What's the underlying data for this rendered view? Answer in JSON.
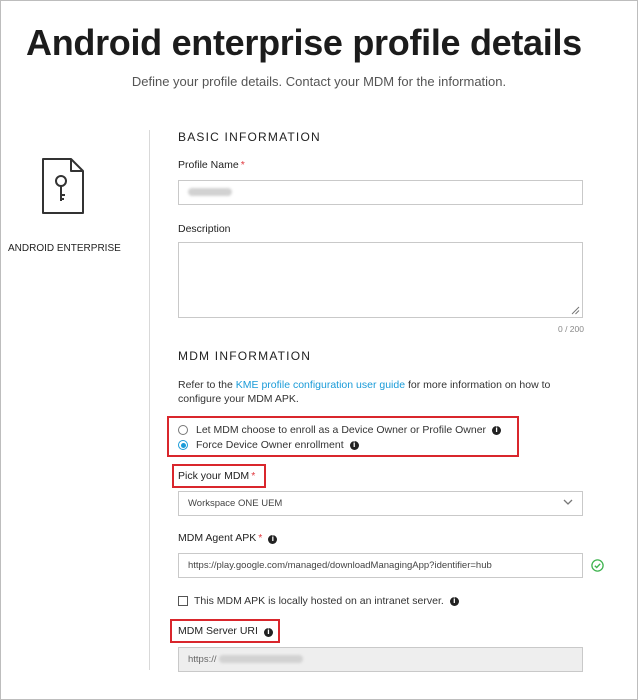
{
  "page": {
    "title": "Android enterprise profile details",
    "subtitle": "Define your profile details. Contact your MDM for the information."
  },
  "sidebar": {
    "profile_type_label": "ANDROID ENTERPRISE",
    "icon": "key-file-icon"
  },
  "basic_info": {
    "heading": "BASIC INFORMATION",
    "profile_name": {
      "label": "Profile Name",
      "required_mark": "*",
      "value": ""
    },
    "description": {
      "label": "Description",
      "value": "",
      "counter": "0 / 200"
    }
  },
  "mdm_info": {
    "heading": "MDM INFORMATION",
    "help_prefix": "Refer to the ",
    "help_link": "KME profile configuration user guide",
    "help_suffix": " for more information on how to configure your MDM APK.",
    "enrollment_options": [
      {
        "label": "Let MDM choose to enroll as a Device Owner or Profile Owner",
        "selected": false
      },
      {
        "label": "Force Device Owner enrollment",
        "selected": true
      }
    ],
    "pick_mdm": {
      "label": "Pick your MDM",
      "required_mark": "*",
      "selected": "Workspace ONE UEM"
    },
    "agent_apk": {
      "label": "MDM Agent APK",
      "required_mark": "*",
      "value": "https://play.google.com/managed/downloadManagingApp?identifier=hub",
      "valid": true
    },
    "intranet_checkbox": {
      "label": "This MDM APK is locally hosted on an intranet server.",
      "checked": false
    },
    "server_uri": {
      "label": "MDM Server URI",
      "value_prefix": "https://"
    }
  },
  "colors": {
    "accent": "#1a9bd8",
    "required": "#e0383e",
    "highlight": "#d9262c",
    "valid": "#3fb34f"
  }
}
